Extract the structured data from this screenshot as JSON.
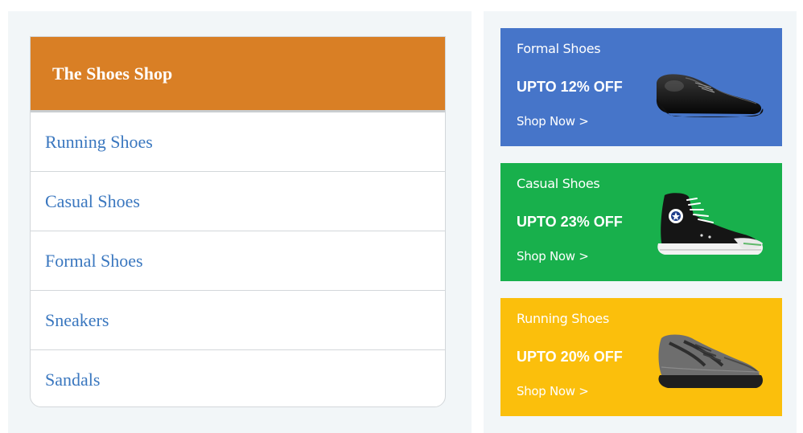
{
  "menu": {
    "title": "The Shoes Shop",
    "items": [
      {
        "label": "Running Shoes"
      },
      {
        "label": "Casual Shoes"
      },
      {
        "label": "Formal Shoes"
      },
      {
        "label": "Sneakers"
      },
      {
        "label": "Sandals"
      }
    ],
    "header_color": "#d97f25",
    "link_color": "#3a77bf"
  },
  "promos": [
    {
      "category": "Formal Shoes",
      "offer": "UPTO 12% OFF",
      "cta": "Shop Now >",
      "color": "#4675c9",
      "icon": "formal-shoe-icon"
    },
    {
      "category": "Casual Shoes",
      "offer": "UPTO 23% OFF",
      "cta": "Shop Now >",
      "color": "#18b04c",
      "icon": "sneaker-icon"
    },
    {
      "category": "Running Shoes",
      "offer": "UPTO 20% OFF",
      "cta": "Shop Now >",
      "color": "#fbbf0c",
      "icon": "hiking-shoe-icon"
    }
  ]
}
